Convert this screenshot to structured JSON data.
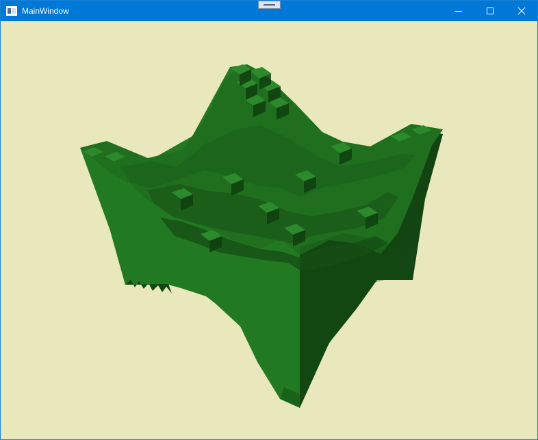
{
  "window": {
    "title": "MainWindow",
    "background": "#e9e8bc",
    "titlebar_color": "#0078d7"
  },
  "titlebar": {
    "icons": [
      "window-app-icon",
      "minimize-icon",
      "maximize-icon",
      "close-icon"
    ]
  },
  "scene": {
    "description_type": "3d-voxel-surface",
    "colors": {
      "top": "#237a23",
      "front": "#217a21",
      "side": "#124512",
      "dark_side": "#0f3f0f"
    }
  }
}
